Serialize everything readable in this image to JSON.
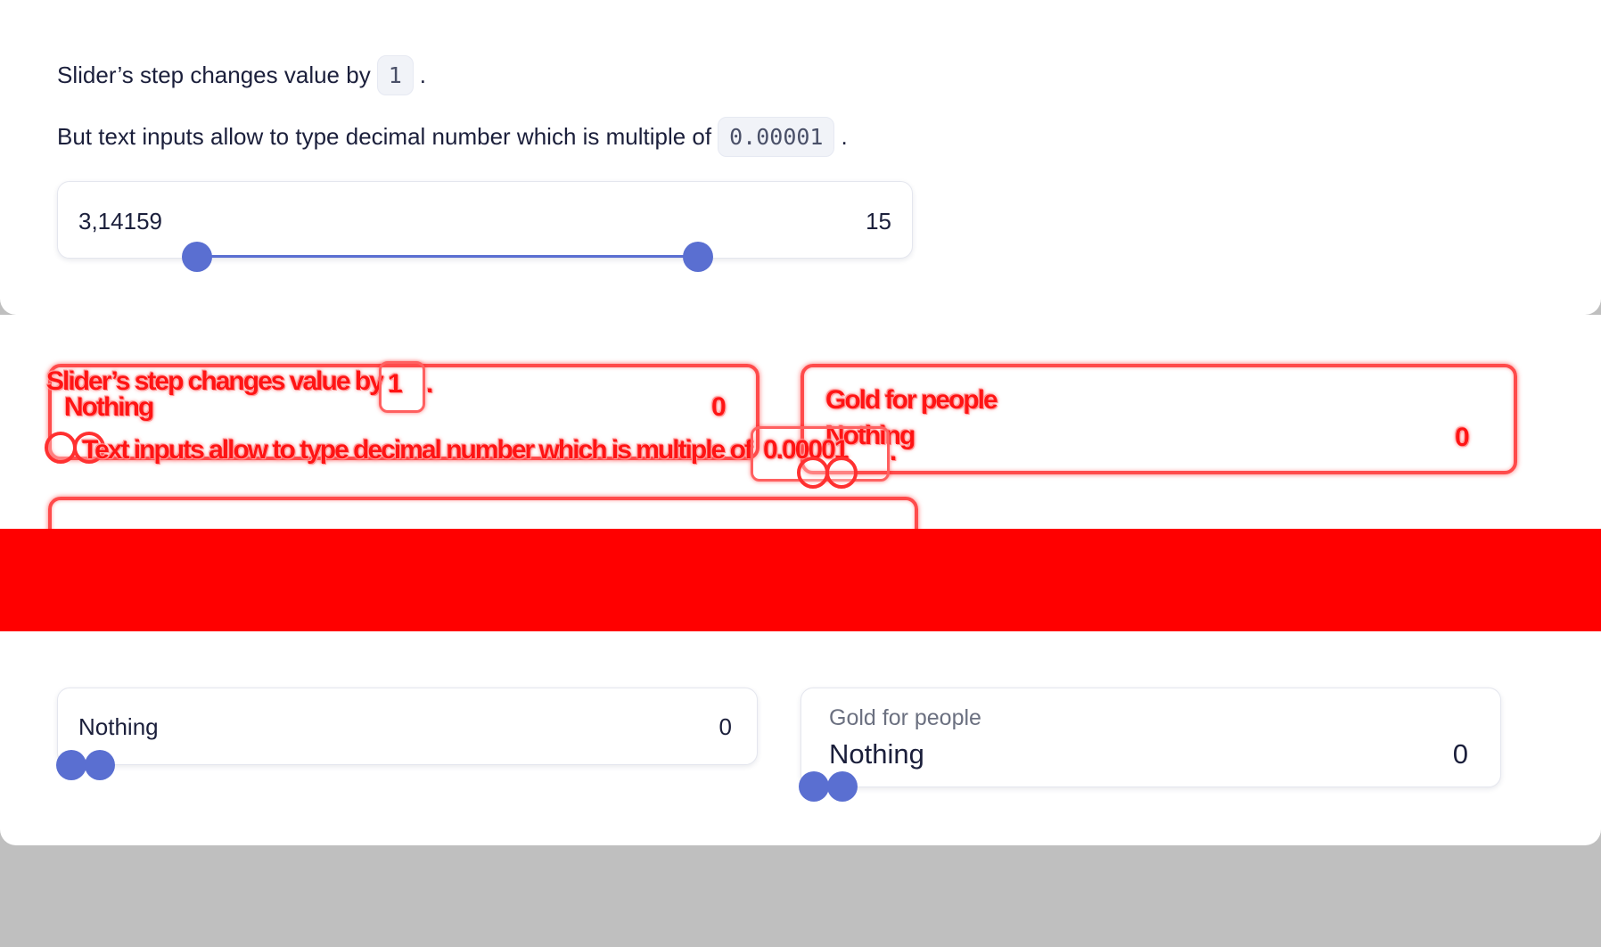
{
  "range_demo": {
    "line1_text": "Slider’s step changes value by",
    "step_value": "1",
    "line1_period": ".",
    "line2_text": "But text inputs allow to type decimal number which is multiple of",
    "multiple_value": "0.00001",
    "line2_period": ".",
    "left_input_value": "3,14159",
    "right_input_value": "15",
    "slider": {
      "min_value": 3.14159,
      "max_value": 15
    }
  },
  "overlay_echo": {
    "line1_text": "Slider’s step changes value by",
    "step_value": "1",
    "period": ".",
    "line2_text": "Text inputs allow to type decimal number which is multiple of",
    "multiple_value": "0.00001",
    "card1_label": "Nothing",
    "card1_value": "0",
    "card2_title": "Gold for people",
    "card2_label": "Nothing",
    "card2_value": "0"
  },
  "nothing_slider": {
    "left_label": "Nothing",
    "right_value": "0"
  },
  "gold_slider": {
    "title": "Gold for people",
    "left_label": "Nothing",
    "right_value": "0"
  },
  "colors": {
    "accent": "#5a6fd1",
    "overlay_red": "#ff0000",
    "backdrop": "#bfbfbf"
  }
}
